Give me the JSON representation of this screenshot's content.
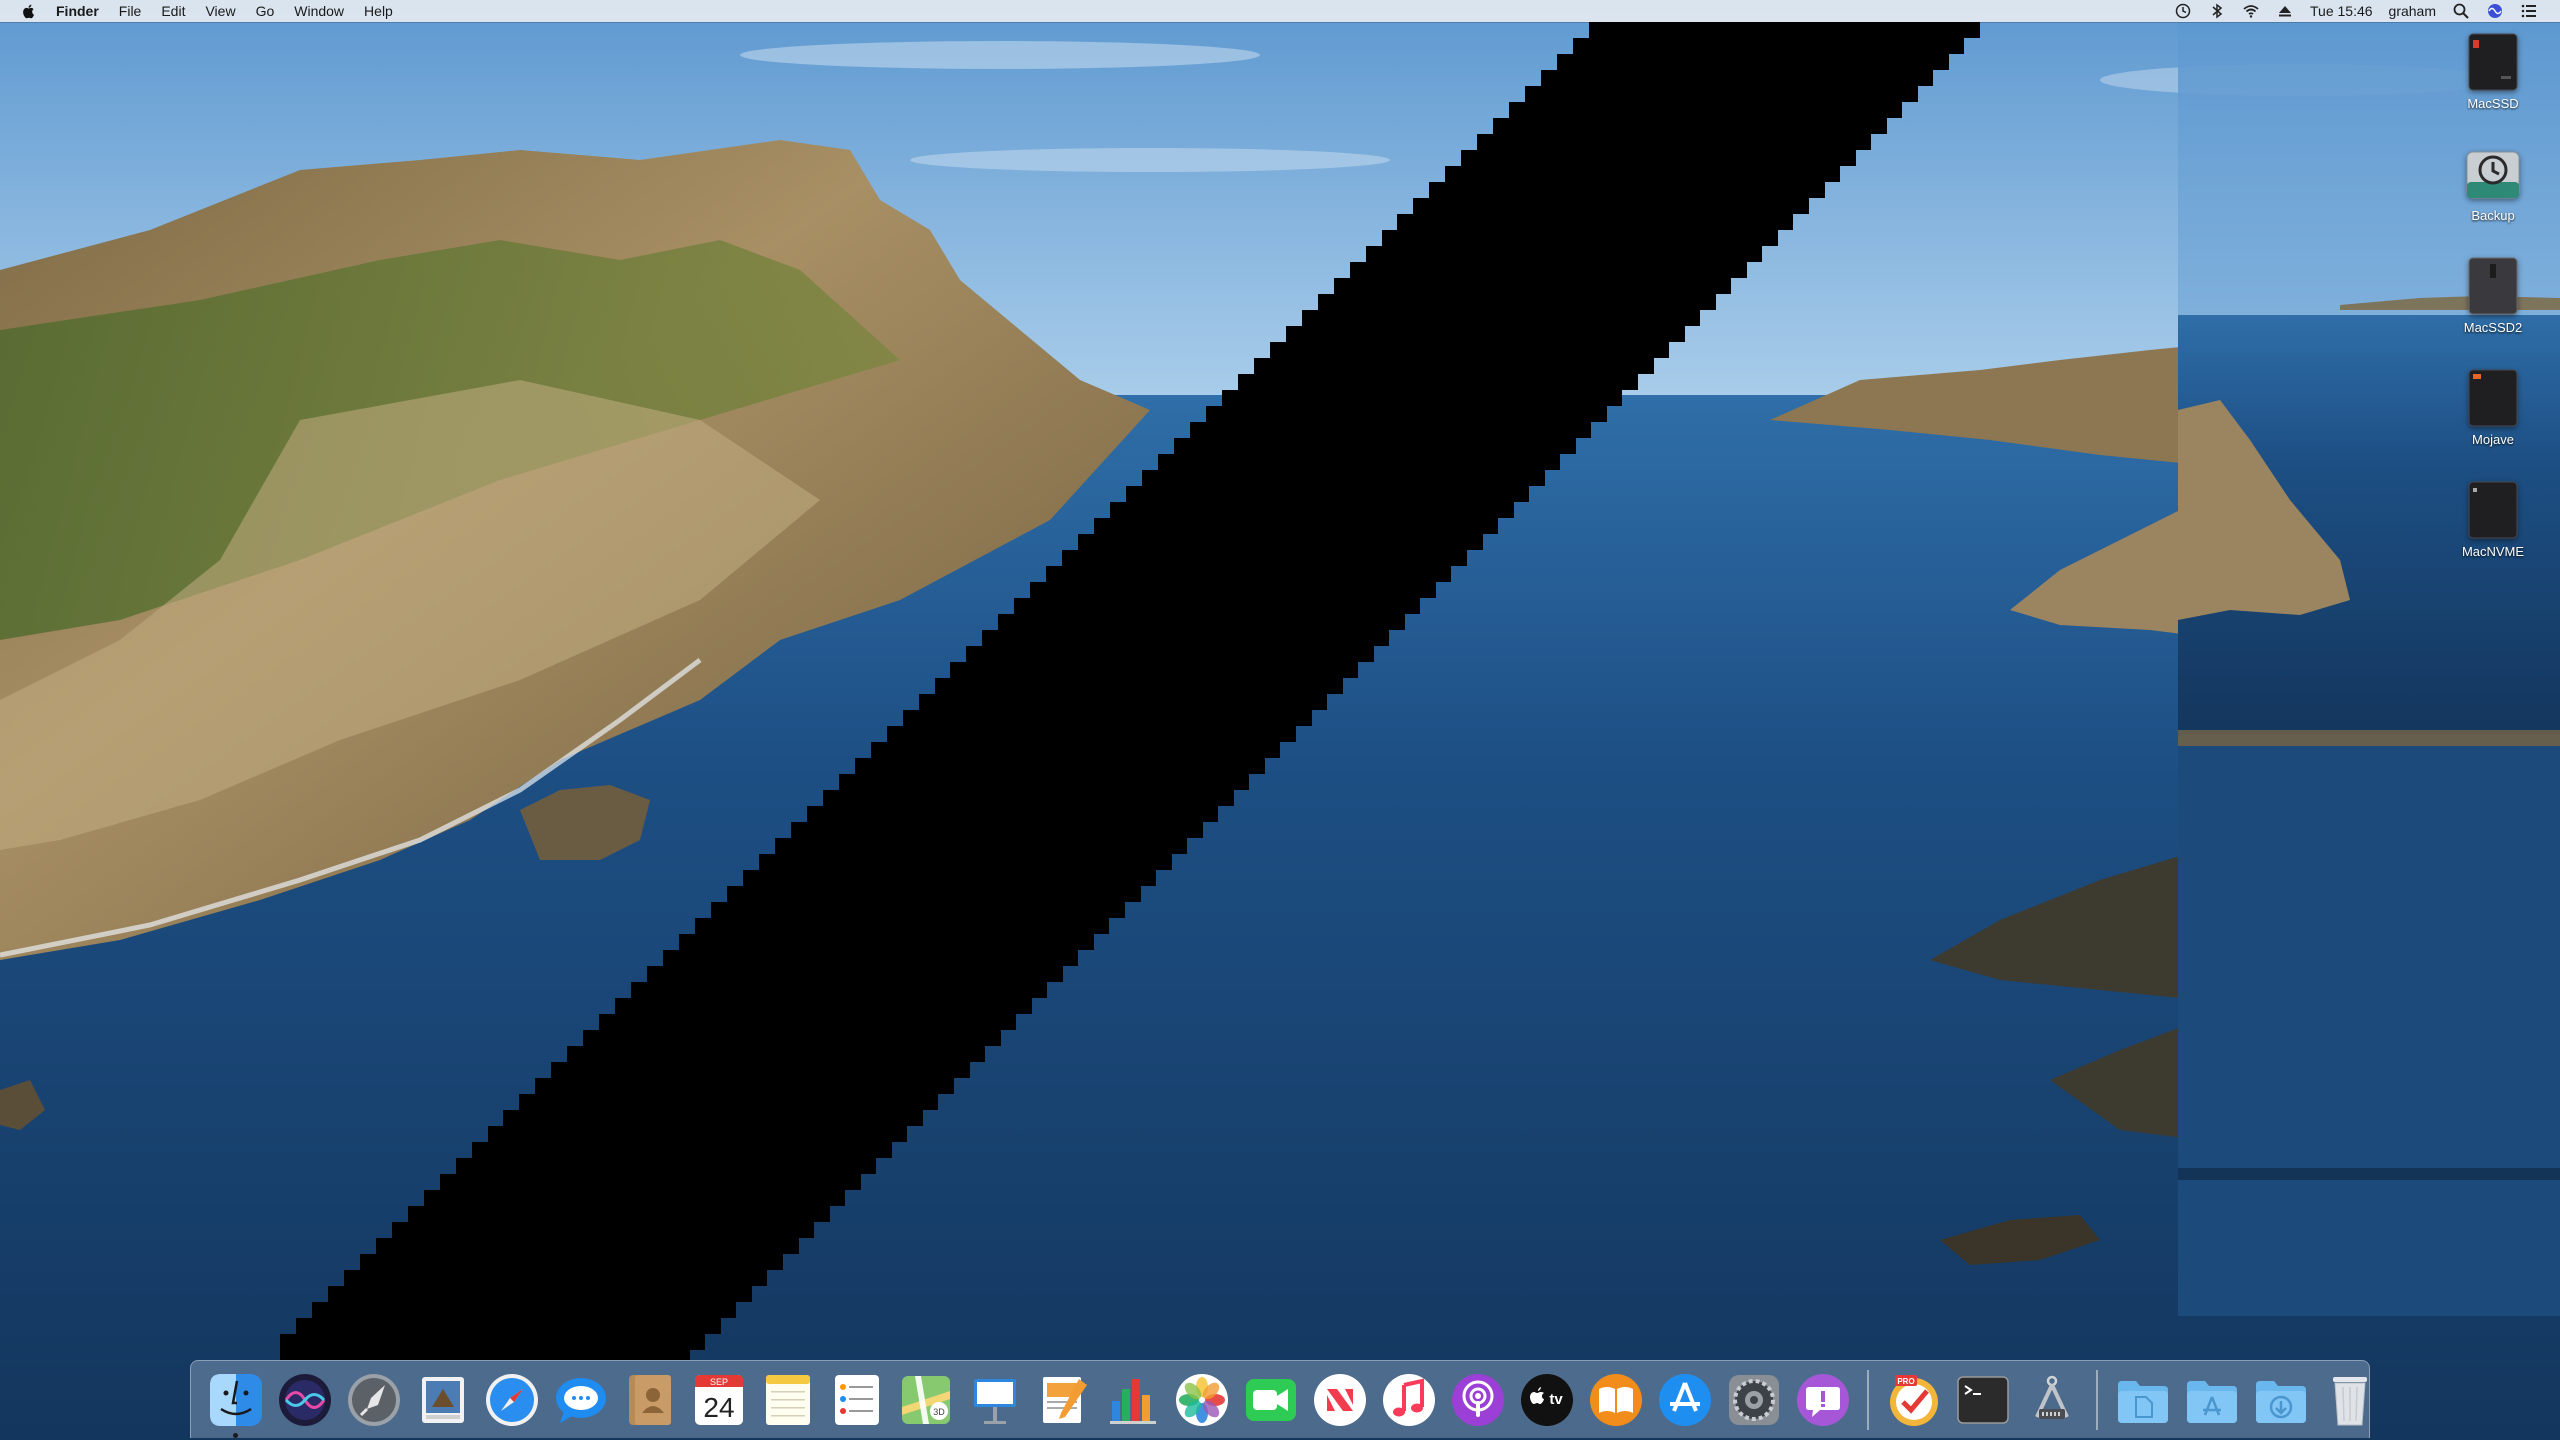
{
  "menubar": {
    "app_name": "Finder",
    "menus": [
      "File",
      "Edit",
      "View",
      "Go",
      "Window",
      "Help"
    ],
    "clock": "Tue 15:46",
    "user": "graham",
    "status_icons": [
      "time-machine-icon",
      "bluetooth-icon",
      "wifi-icon",
      "eject-icon"
    ],
    "trailing_icons": [
      "spotlight-icon",
      "siri-icon",
      "control-center-icon"
    ]
  },
  "desktop_drives": [
    {
      "label": "MacSSD",
      "icon": "ssd-drive-icon"
    },
    {
      "label": "Backup",
      "icon": "time-machine-drive-icon"
    },
    {
      "label": "MacSSD2",
      "icon": "ssd-drive-icon"
    },
    {
      "label": "Mojave",
      "icon": "ssd-drive-icon"
    },
    {
      "label": "MacNVME",
      "icon": "ssd-drive-icon"
    }
  ],
  "dock": {
    "calendar_month": "SEP",
    "calendar_day": "24",
    "tv_label": "tv",
    "badge_pro": "PRO",
    "apps": [
      "finder-icon",
      "siri-icon",
      "launchpad-icon",
      "preview-icon",
      "safari-icon",
      "messages-icon",
      "contacts-icon",
      "calendar-icon",
      "notes-icon",
      "reminders-icon",
      "maps-icon",
      "keynote-icon",
      "pages-icon",
      "numbers-icon",
      "photos-icon",
      "facetime-icon",
      "news-icon",
      "music-icon",
      "podcasts-icon",
      "apple-tv-icon",
      "books-icon",
      "app-store-icon",
      "system-preferences-icon",
      "feedback-assistant-icon"
    ],
    "extras": [
      "omnifocus-icon",
      "terminal-icon",
      "system-information-icon"
    ],
    "folders": [
      "documents-folder-icon",
      "applications-folder-icon",
      "downloads-folder-icon",
      "trash-icon"
    ]
  },
  "colors": {
    "sky": "#6fa7d8",
    "sea": "#1b4a7a",
    "glitch": "#000000"
  }
}
